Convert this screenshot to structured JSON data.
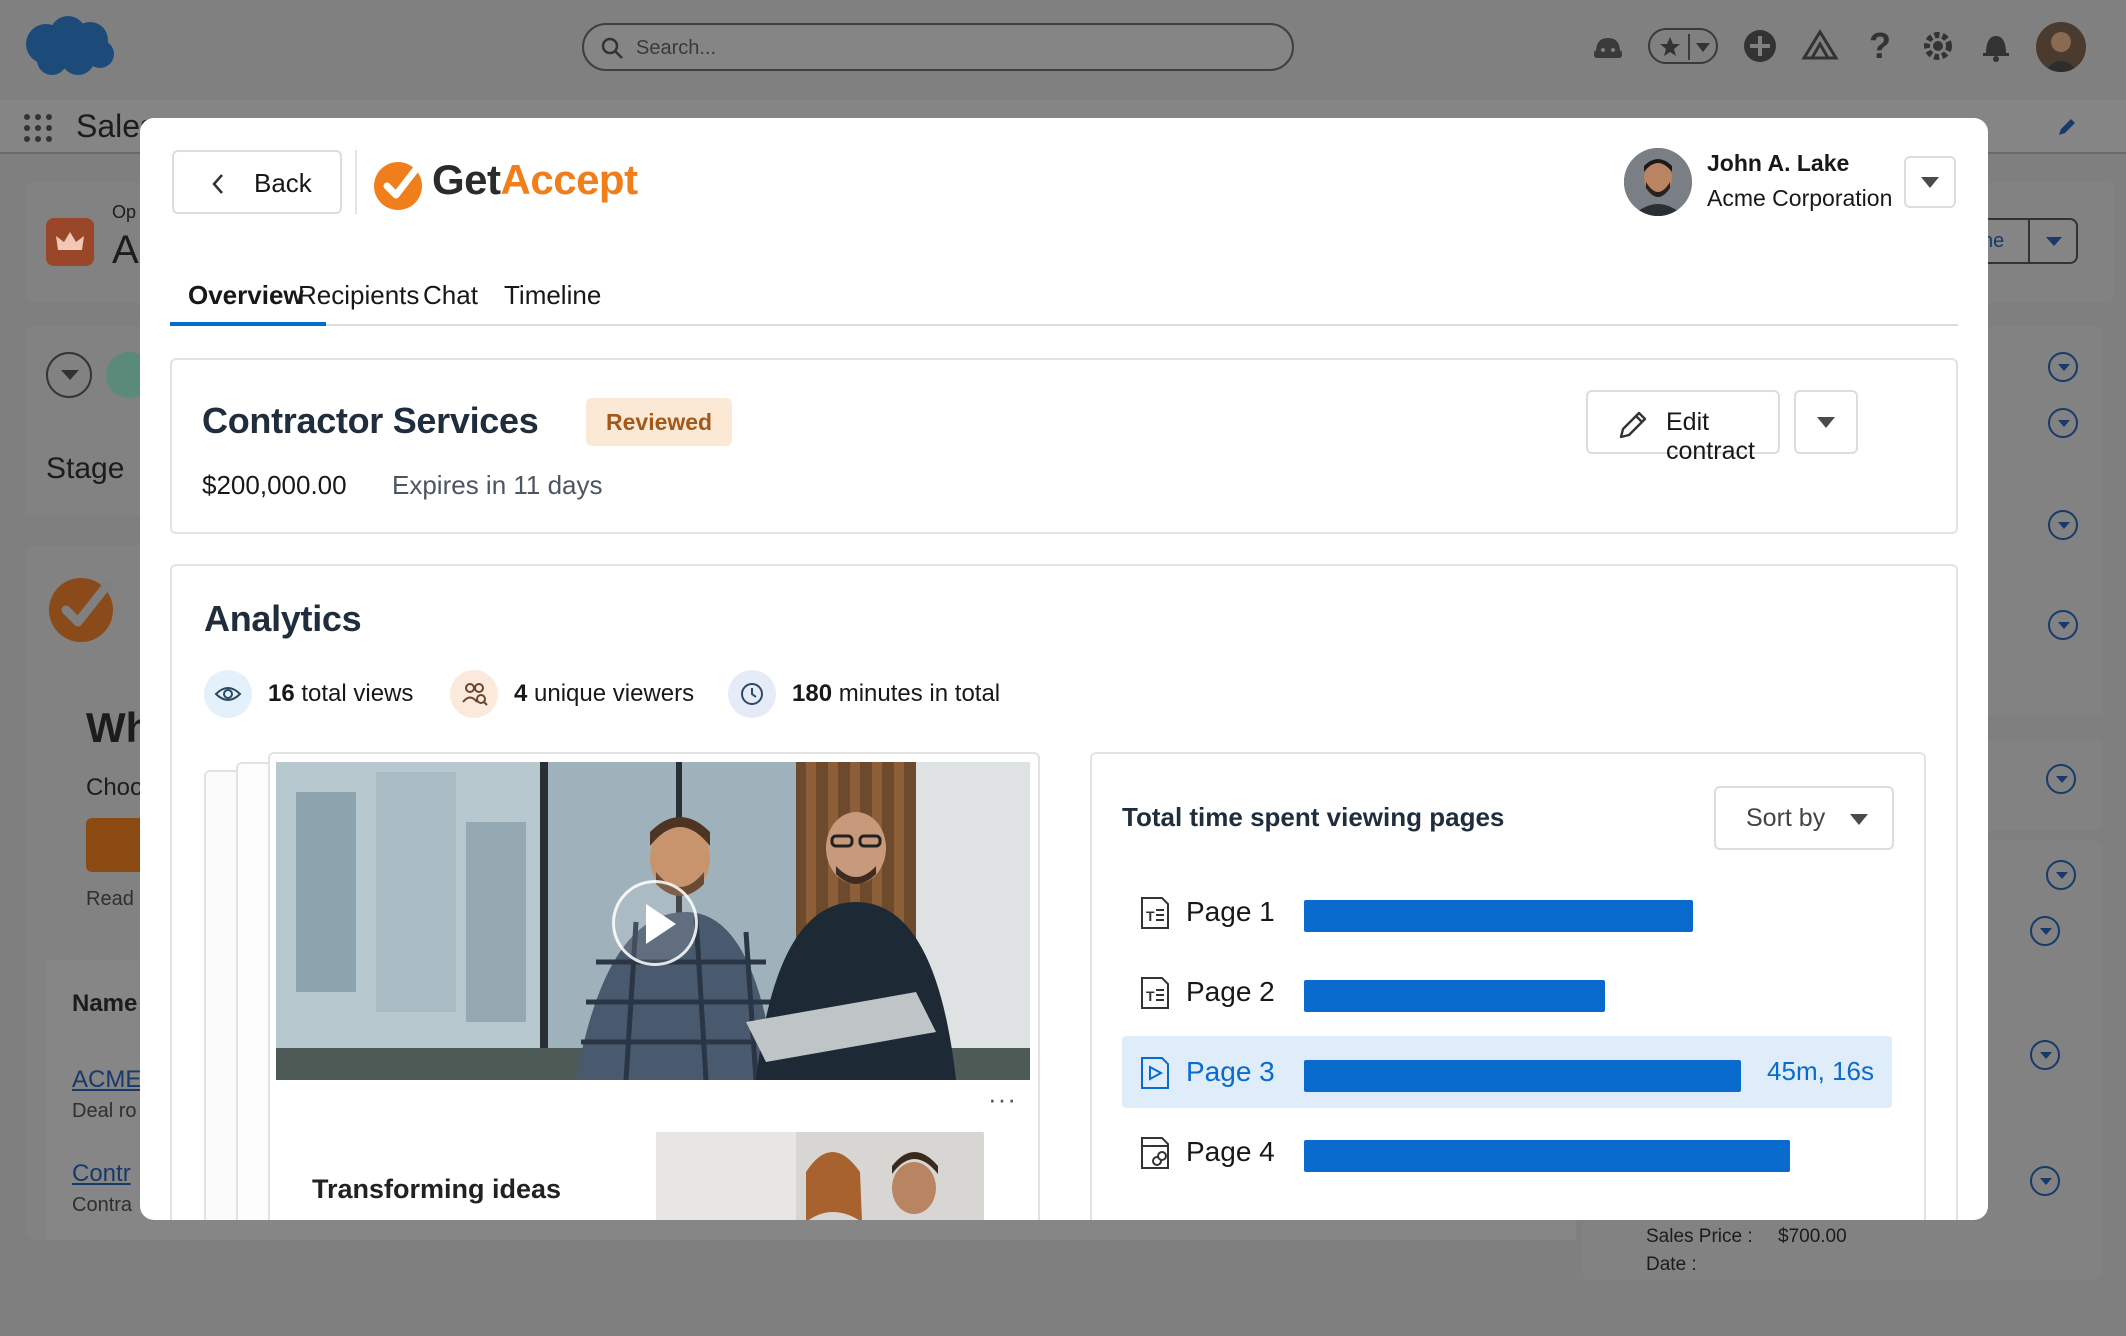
{
  "salesforce": {
    "search_placeholder": "Search...",
    "app_name": "Sales",
    "record_type_label": "Op",
    "record_title_initial": "A",
    "stage_label": "Stage",
    "panel_heading": "Wh",
    "panel_sub": "Choo",
    "panel_read": "Read",
    "table_header_name": "Name",
    "row1_link": "ACME",
    "row1_sub": "Deal ro",
    "row2_link": "Contr",
    "row2_sub": "Contra",
    "right_button_partial": "ne",
    "sales_price_label": "Sales Price :",
    "sales_price_value": "$700.00",
    "date_label": "Date :"
  },
  "modal": {
    "back_label": "Back",
    "brand": {
      "get": "Get",
      "accept": "Accept"
    },
    "user": {
      "name": "John A. Lake",
      "org": "Acme Corporation"
    },
    "tabs": [
      {
        "label": "Overview",
        "active": true
      },
      {
        "label": "Recipients",
        "active": false
      },
      {
        "label": "Chat",
        "active": false
      },
      {
        "label": "Timeline",
        "active": false
      }
    ],
    "contract": {
      "title": "Contractor Services",
      "status": "Reviewed",
      "amount": "$200,000.00",
      "expires": "Expires in 11 days",
      "edit_label": "Edit contract"
    },
    "analytics": {
      "title": "Analytics",
      "stats": [
        {
          "value": "16",
          "label": "total views",
          "icon": "eye-icon"
        },
        {
          "value": "4",
          "label": "unique viewers",
          "icon": "viewers-icon"
        },
        {
          "value": "180",
          "label": "minutes in total",
          "icon": "clock-icon"
        }
      ],
      "document_caption": "Transforming ideas",
      "time_spent": {
        "title": "Total time spent viewing pages",
        "sort_label": "Sort by",
        "pages": [
          {
            "label": "Page 1",
            "fraction": 0.8,
            "value": "",
            "highlight": false,
            "icon": "text-page-icon"
          },
          {
            "label": "Page 2",
            "fraction": 0.62,
            "value": "",
            "highlight": false,
            "icon": "text-page-icon"
          },
          {
            "label": "Page 3",
            "fraction": 0.9,
            "value": "45m, 16s",
            "highlight": true,
            "icon": "video-page-icon"
          },
          {
            "label": "Page 4",
            "fraction": 1.0,
            "value": "",
            "highlight": false,
            "icon": "link-page-icon"
          }
        ]
      }
    }
  },
  "colors": {
    "accent": "#0a6bcf",
    "brand_orange": "#f07e1b",
    "badge_bg": "#fbe9d6",
    "badge_text": "#a2591a",
    "highlight_row": "#dfedfa"
  }
}
